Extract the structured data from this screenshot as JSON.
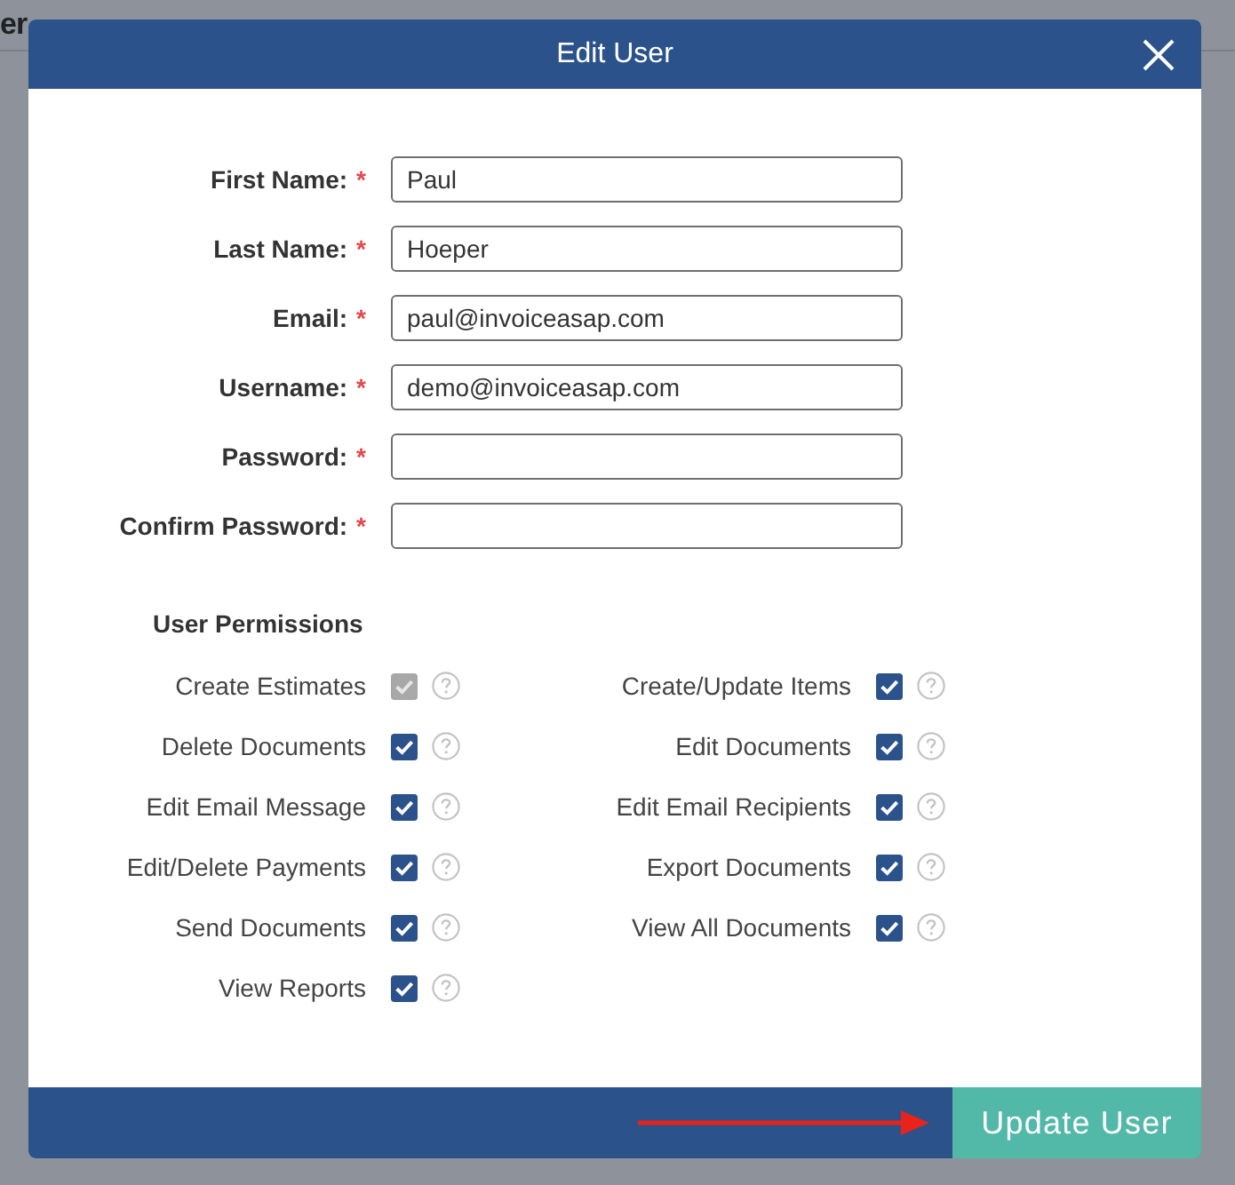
{
  "background_page": {
    "heading": "er"
  },
  "dialog": {
    "title": "Edit User"
  },
  "fields": [
    {
      "label": "First Name:",
      "required_mark": "*",
      "value": "Paul"
    },
    {
      "label": "Last Name:",
      "required_mark": "*",
      "value": "Hoeper"
    },
    {
      "label": "Email:",
      "required_mark": "*",
      "value": "paul@invoiceasap.com"
    },
    {
      "label": "Username:",
      "required_mark": "*",
      "value": "demo@invoiceasap.com"
    },
    {
      "label": "Password:",
      "required_mark": "*"
    },
    {
      "label": "Confirm Password:",
      "required_mark": "*"
    }
  ],
  "permissions": {
    "title": "User Permissions",
    "columns": [
      {
        "items": [
          {
            "label": "Create Estimates",
            "checked": true,
            "disabled": true
          },
          {
            "label": "Delete Documents",
            "checked": true,
            "disabled": false
          },
          {
            "label": "Edit Email Message",
            "checked": true,
            "disabled": false
          },
          {
            "label": "Edit/Delete Payments",
            "checked": true,
            "disabled": false
          },
          {
            "label": "Send Documents",
            "checked": true,
            "disabled": false
          },
          {
            "label": "View Reports",
            "checked": true,
            "disabled": false
          }
        ]
      },
      {
        "items": [
          {
            "label": "Create/Update Items",
            "checked": true,
            "disabled": false
          },
          {
            "label": "Edit Documents",
            "checked": true,
            "disabled": false
          },
          {
            "label": "Edit Email Recipients",
            "checked": true,
            "disabled": false
          },
          {
            "label": "Export Documents",
            "checked": true,
            "disabled": false
          },
          {
            "label": "View All Documents",
            "checked": true,
            "disabled": false
          }
        ]
      }
    ]
  },
  "footer": {
    "submit_button": "Update User"
  }
}
